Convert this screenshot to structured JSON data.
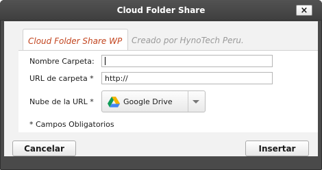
{
  "window": {
    "title": "Cloud Folder Share",
    "close_label": "×"
  },
  "tab": {
    "label": "Cloud Folder Share WP",
    "subtitle": "Creado por HynoTech Peru."
  },
  "form": {
    "folder_name_label": "Nombre Carpeta:",
    "folder_name_value": "",
    "url_label": "URL de carpeta *",
    "url_value": "http://",
    "cloud_label": "Nube de la URL *",
    "cloud_selected": "Google Drive",
    "required_note": "* Campos Obligatorios"
  },
  "footer": {
    "cancel_label": "Cancelar",
    "insert_label": "Insertar"
  },
  "icons": {
    "close": "close-icon",
    "cloud_provider": "google-drive-icon",
    "dropdown": "chevron-down-icon"
  },
  "colors": {
    "tab_accent": "#c2441e",
    "titlebar": "#4a4a4a",
    "drive_green": "#0f9d58",
    "drive_yellow": "#f4b400",
    "drive_blue": "#4285f4"
  }
}
